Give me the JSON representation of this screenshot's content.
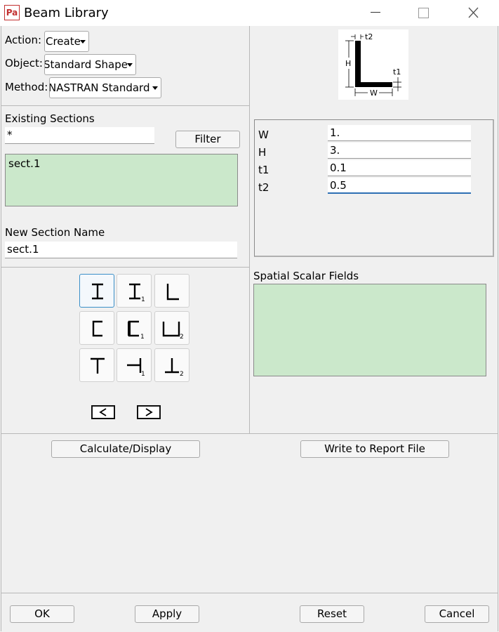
{
  "window": {
    "app_icon_text": "Pa",
    "title": "Beam Library",
    "minimize_icon": "minimize-icon",
    "maximize_icon": "maximize-icon",
    "close_icon": "close-icon"
  },
  "form": {
    "action_label": "Action:",
    "action_value": "Create",
    "object_label": "Object:",
    "object_value": "Standard Shape",
    "method_label": "Method:",
    "method_value": "NASTRAN Standard"
  },
  "existing_sections": {
    "label": "Existing Sections",
    "filter_value": "*",
    "filter_button": "Filter",
    "items": [
      "sect.1"
    ]
  },
  "new_section": {
    "label": "New Section Name",
    "value": "sect.1"
  },
  "diagram": {
    "t2": "t2",
    "h": "H",
    "t1": "t1",
    "w": "W"
  },
  "parameters": [
    {
      "name": "W",
      "value": "1."
    },
    {
      "name": "H",
      "value": "3."
    },
    {
      "name": "t1",
      "value": "0.1"
    },
    {
      "name": "t2",
      "value": "0.5"
    }
  ],
  "spatial": {
    "label": "Spatial Scalar Fields"
  },
  "shape_buttons": [
    {
      "name": "i-beam-icon",
      "sub": ""
    },
    {
      "name": "i-beam-1-icon",
      "sub": "1"
    },
    {
      "name": "l-section-icon",
      "sub": ""
    },
    {
      "name": "channel-icon",
      "sub": ""
    },
    {
      "name": "channel-1-icon",
      "sub": "1"
    },
    {
      "name": "channel-2-icon",
      "sub": "2"
    },
    {
      "name": "t-section-icon",
      "sub": ""
    },
    {
      "name": "t-section-1-icon",
      "sub": "1"
    },
    {
      "name": "t-section-2-icon",
      "sub": "2"
    }
  ],
  "nav": {
    "prev": "<",
    "next": ">"
  },
  "actions": {
    "calculate": "Calculate/Display",
    "report": "Write to Report File"
  },
  "footer": {
    "ok": "OK",
    "apply": "Apply",
    "reset": "Reset",
    "cancel": "Cancel"
  }
}
